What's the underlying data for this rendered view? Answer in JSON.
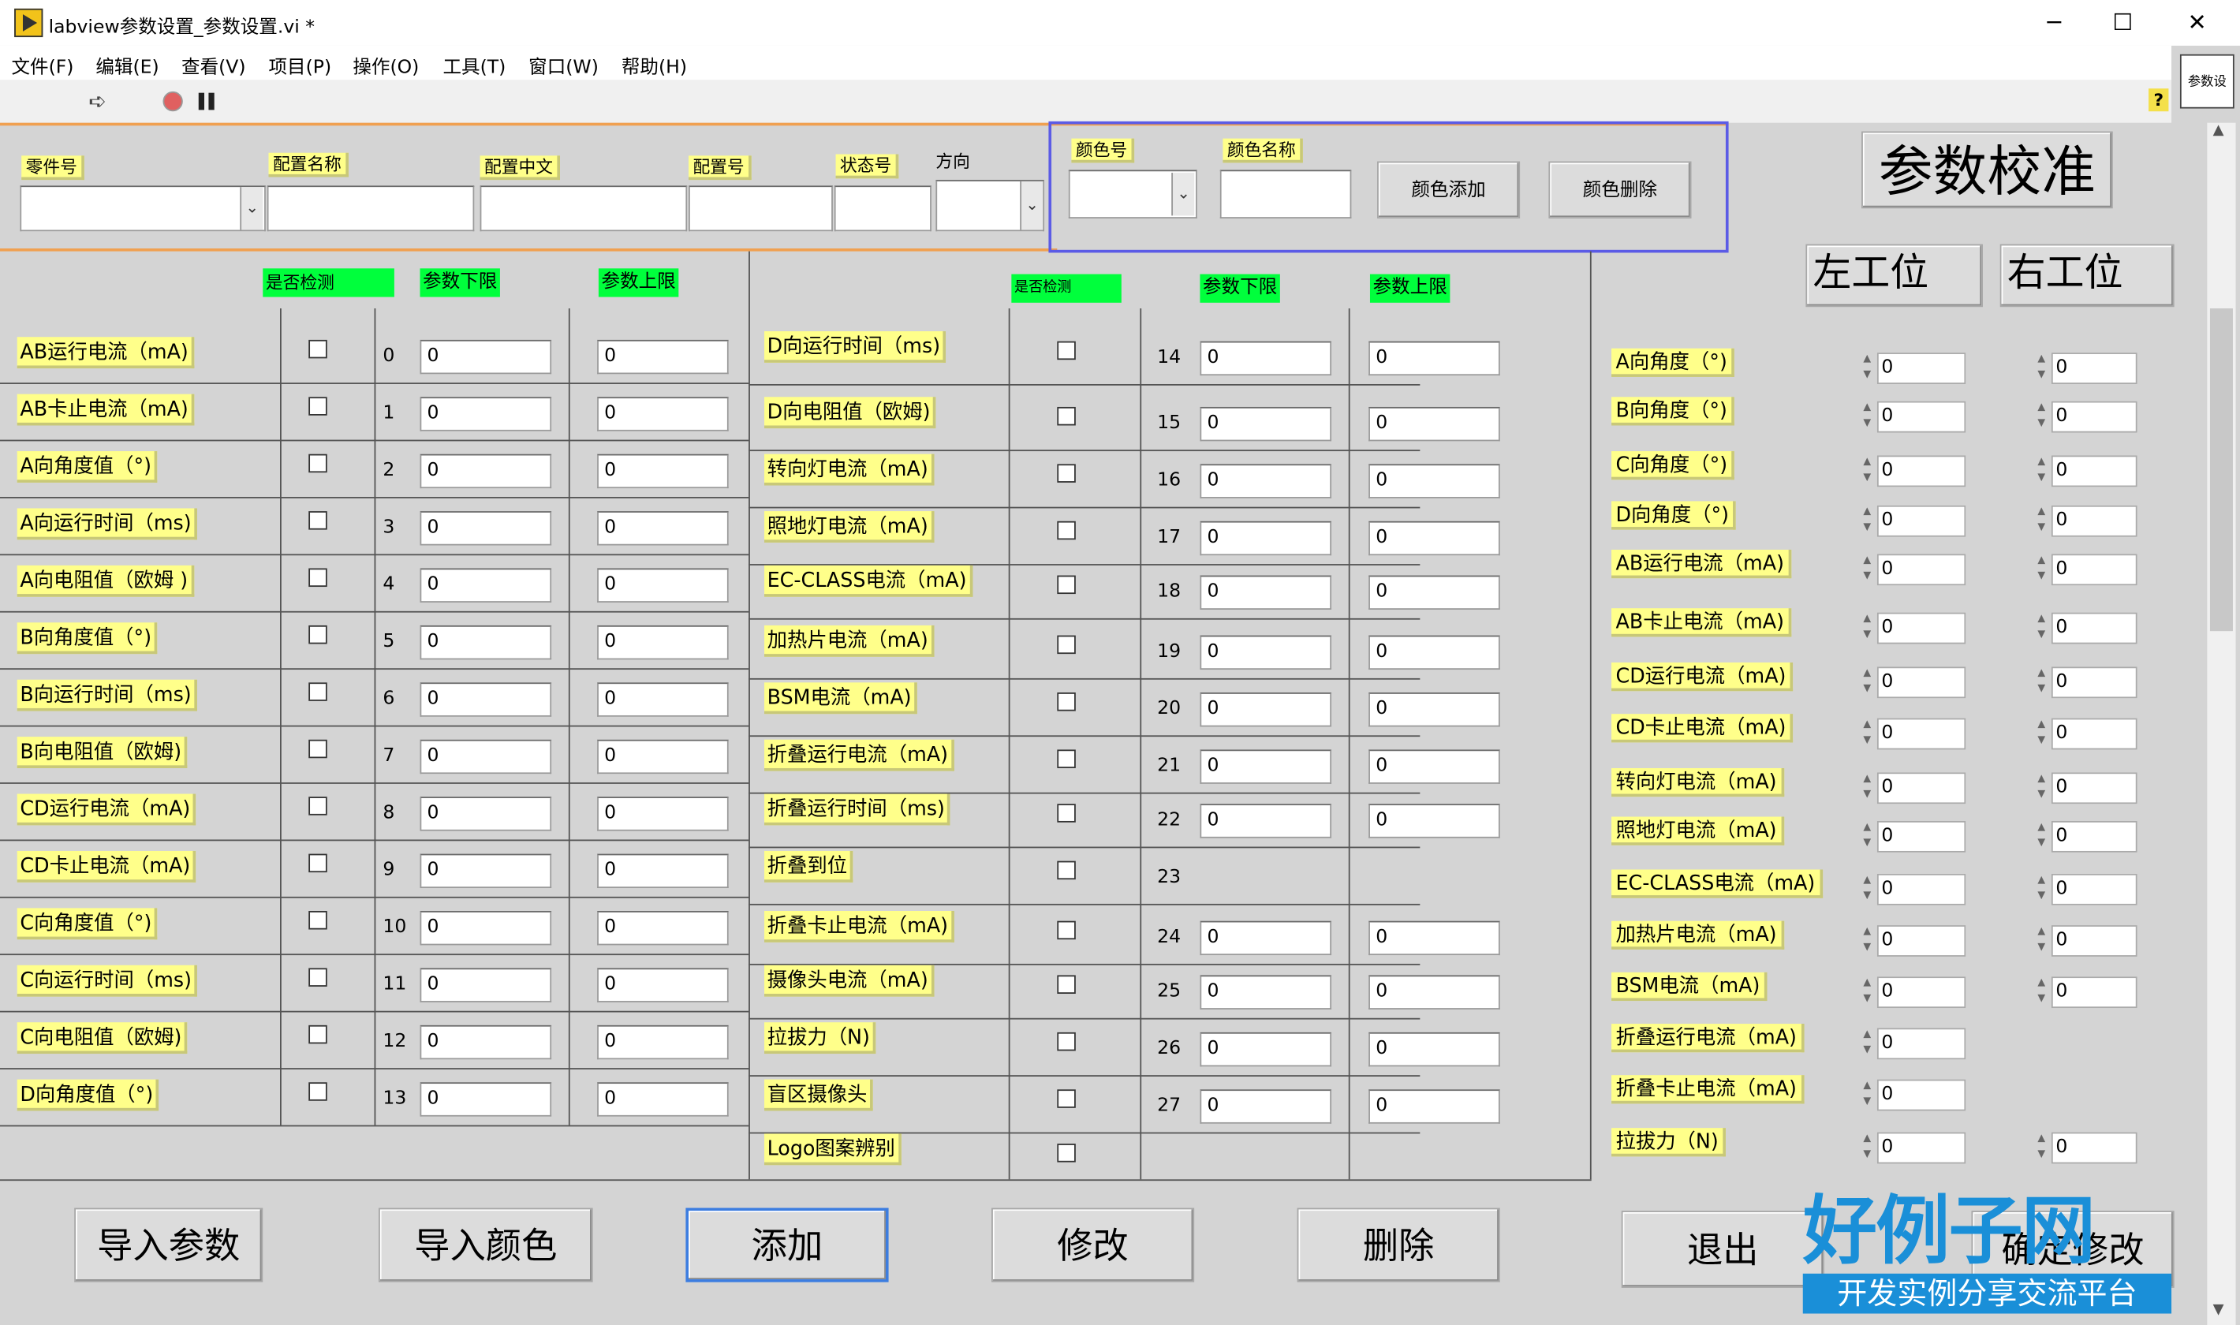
{
  "window": {
    "title": "labview参数设置_参数设置.vi *",
    "minimize": "─",
    "maximize": "☐",
    "close": "✕"
  },
  "menus": [
    "文件(F)",
    "编辑(E)",
    "查看(V)",
    "项目(P)",
    "操作(O)",
    "工具(T)",
    "窗口(W)",
    "帮助(H)"
  ],
  "vi_thumb": "参数设",
  "help": "?",
  "header": {
    "part_no": "零件号",
    "config_name": "配置名称",
    "config_cn": "配置中文",
    "config_no": "配置号",
    "state_no": "状态号",
    "direction": "方向",
    "color_no": "颜色号",
    "color_name": "颜色名称",
    "color_add": "颜色添加",
    "color_del": "颜色删除"
  },
  "title": "参数校准",
  "stations": {
    "left": "左工位",
    "right": "右工位"
  },
  "col_heads": {
    "check": "是否检测",
    "lower": "参数下限",
    "upper": "参数上限",
    "check2": "是否检测",
    "lower2": "参数下限",
    "upper2": "参数上限"
  },
  "left_rows": [
    {
      "label": "AB运行电流（mA)",
      "idx": "0",
      "lo": "0",
      "hi": "0"
    },
    {
      "label": "AB卡止电流（mA)",
      "idx": "1",
      "lo": "0",
      "hi": "0"
    },
    {
      "label": "A向角度值（°)",
      "idx": "2",
      "lo": "0",
      "hi": "0"
    },
    {
      "label": "A向运行时间（ms)",
      "idx": "3",
      "lo": "0",
      "hi": "0"
    },
    {
      "label": "A向电阻值（欧姆 )",
      "idx": "4",
      "lo": "0",
      "hi": "0"
    },
    {
      "label": "B向角度值（°)",
      "idx": "5",
      "lo": "0",
      "hi": "0"
    },
    {
      "label": "B向运行时间（ms)",
      "idx": "6",
      "lo": "0",
      "hi": "0"
    },
    {
      "label": "B向电阻值（欧姆)",
      "idx": "7",
      "lo": "0",
      "hi": "0"
    },
    {
      "label": "CD运行电流（mA)",
      "idx": "8",
      "lo": "0",
      "hi": "0"
    },
    {
      "label": "CD卡止电流（mA)",
      "idx": "9",
      "lo": "0",
      "hi": "0"
    },
    {
      "label": "C向角度值（°)",
      "idx": "10",
      "lo": "0",
      "hi": "0"
    },
    {
      "label": "C向运行时间（ms)",
      "idx": "11",
      "lo": "0",
      "hi": "0"
    },
    {
      "label": "C向电阻值（欧姆)",
      "idx": "12",
      "lo": "0",
      "hi": "0"
    },
    {
      "label": "D向角度值（°)",
      "idx": "13",
      "lo": "0",
      "hi": "0"
    }
  ],
  "right_rows": [
    {
      "label": "D向运行时间（ms)",
      "idx": "14",
      "lo": "0",
      "hi": "0"
    },
    {
      "label": "D向电阻值（欧姆)",
      "idx": "15",
      "lo": "0",
      "hi": "0"
    },
    {
      "label": "转向灯电流（mA)",
      "idx": "16",
      "lo": "0",
      "hi": "0"
    },
    {
      "label": "照地灯电流（mA)",
      "idx": "17",
      "lo": "0",
      "hi": "0"
    },
    {
      "label": "EC-CLASS电流（mA)",
      "idx": "18",
      "lo": "0",
      "hi": "0"
    },
    {
      "label": "加热片电流（mA)",
      "idx": "19",
      "lo": "0",
      "hi": "0"
    },
    {
      "label": "BSM电流（mA)",
      "idx": "20",
      "lo": "0",
      "hi": "0"
    },
    {
      "label": "折叠运行电流（mA)",
      "idx": "21",
      "lo": "0",
      "hi": "0"
    },
    {
      "label": "折叠运行时间（ms)",
      "idx": "22",
      "lo": "0",
      "hi": "0"
    },
    {
      "label": "折叠到位",
      "idx": "23",
      "lo": "",
      "hi": ""
    },
    {
      "label": "折叠卡止电流（mA)",
      "idx": "24",
      "lo": "0",
      "hi": "0"
    },
    {
      "label": "摄像头电流（mA)",
      "idx": "25",
      "lo": "0",
      "hi": "0"
    },
    {
      "label": "拉拔力（N)",
      "idx": "26",
      "lo": "0",
      "hi": "0"
    },
    {
      "label": "盲区摄像头",
      "idx": "27",
      "lo": "0",
      "hi": "0"
    },
    {
      "label": "Logo图案辨别",
      "idx": "",
      "lo": "",
      "hi": ""
    }
  ],
  "calib_rows": [
    {
      "label": "A向角度（°)",
      "left": "0",
      "right": "0"
    },
    {
      "label": "B向角度（°)",
      "left": "0",
      "right": "0"
    },
    {
      "label": "C向角度（°)",
      "left": "0",
      "right": "0"
    },
    {
      "label": "D向角度（°)",
      "left": "0",
      "right": "0"
    },
    {
      "label": "AB运行电流（mA)",
      "left": "0",
      "right": "0"
    },
    {
      "label": "AB卡止电流（mA)",
      "left": "0",
      "right": "0"
    },
    {
      "label": "CD运行电流（mA)",
      "left": "0",
      "right": "0"
    },
    {
      "label": "CD卡止电流（mA)",
      "left": "0",
      "right": "0"
    },
    {
      "label": "转向灯电流（mA)",
      "left": "0",
      "right": "0"
    },
    {
      "label": "照地灯电流（mA)",
      "left": "0",
      "right": "0"
    },
    {
      "label": "EC-CLASS电流（mA)",
      "left": "0",
      "right": "0"
    },
    {
      "label": "加热片电流（mA)",
      "left": "0",
      "right": "0"
    },
    {
      "label": "BSM电流（mA)",
      "left": "0",
      "right": "0"
    },
    {
      "label": "折叠运行电流（mA)",
      "left": "0",
      "right": ""
    },
    {
      "label": "折叠卡止电流（mA)",
      "left": "0",
      "right": ""
    },
    {
      "label": "拉拔力（N)",
      "left": "0",
      "right": "0"
    }
  ],
  "buttons": {
    "import_params": "导入参数",
    "import_colors": "导入颜色",
    "add": "添加",
    "modify": "修改",
    "delete": "删除",
    "exit": "退出",
    "confirm": "确定修改"
  },
  "watermark": {
    "big": "好例子网",
    "small": "开发实例分享交流平台"
  },
  "colors": {
    "accent_frame": "#5b5be6",
    "orange_line": "#f0a050",
    "label_yellow": "#ffff8a",
    "head_green": "#00ff3c"
  }
}
